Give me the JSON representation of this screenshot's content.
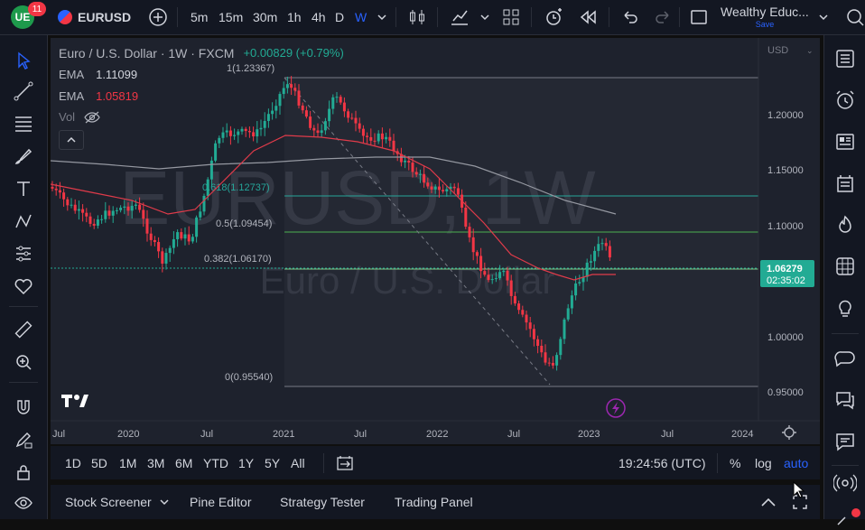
{
  "header": {
    "notifications": "11",
    "symbol": "EURUSD",
    "timeframes": [
      "5m",
      "15m",
      "30m",
      "1h",
      "4h",
      "D",
      "W"
    ],
    "active_timeframe": "W",
    "layout_name": "Wealthy Educ...",
    "layout_save": "Save"
  },
  "legend": {
    "title": "Euro / U.S. Dollar · 1W · FXCM",
    "change": "+0.00829 (+0.79%)",
    "ema1_label": "EMA",
    "ema1_value": "1.11099",
    "ema2_label": "EMA",
    "ema2_value": "1.05819",
    "vol_label": "Vol"
  },
  "watermark": {
    "main": "EURUSD, 1W",
    "sub": "Euro / U.S. Dollar"
  },
  "fib_labels": {
    "top": "1(1.23367)",
    "f618": "0.618(1.12737)",
    "f5": "0.5(1.09454)",
    "f382": "0.382(1.06170)",
    "bottom": "0(0.95540)"
  },
  "price_axis": {
    "currency": "USD",
    "ticks": [
      "1.20000",
      "1.15000",
      "1.10000",
      "1.00000",
      "0.95000"
    ],
    "current_price": "1.06279",
    "countdown": "02:35:02"
  },
  "time_axis": {
    "ticks": [
      "Jul",
      "2020",
      "Jul",
      "2021",
      "Jul",
      "2022",
      "Jul",
      "2023",
      "Jul",
      "2024"
    ]
  },
  "colors": {
    "accent": "#2962ff",
    "up": "#26a69a",
    "up_candle": "#22ab94",
    "down": "#f23645",
    "ema_long": "#9598a1",
    "ema_short": "#e03b4a",
    "price_label": "#22ab94",
    "fib_line": "#26a69a"
  },
  "range_bar": {
    "ranges": [
      "1D",
      "5D",
      "1M",
      "3M",
      "6M",
      "YTD",
      "1Y",
      "5Y",
      "All"
    ],
    "clock": "19:24:56 (UTC)",
    "percent": "%",
    "log": "log",
    "auto": "auto"
  },
  "bottom_tabs": [
    "Stock Screener",
    "Pine Editor",
    "Strategy Tester",
    "Trading Panel"
  ],
  "icons": {
    "left": [
      "cursor-icon",
      "trend-line-icon",
      "fib-icon",
      "brush-icon",
      "text-icon",
      "pattern-icon",
      "prediction-icon",
      "heart-icon",
      "ruler-icon",
      "zoom-icon",
      "magnet-icon",
      "lock-draw-icon",
      "lock-icon",
      "eye-icon"
    ],
    "right": [
      "watchlist-icon",
      "alarm-icon",
      "news-icon",
      "calendar-icon",
      "hotlist-icon",
      "ideas-icon",
      "bulb-icon",
      "chat-icon",
      "chats-icon",
      "messages-icon",
      "streams-icon"
    ]
  }
}
